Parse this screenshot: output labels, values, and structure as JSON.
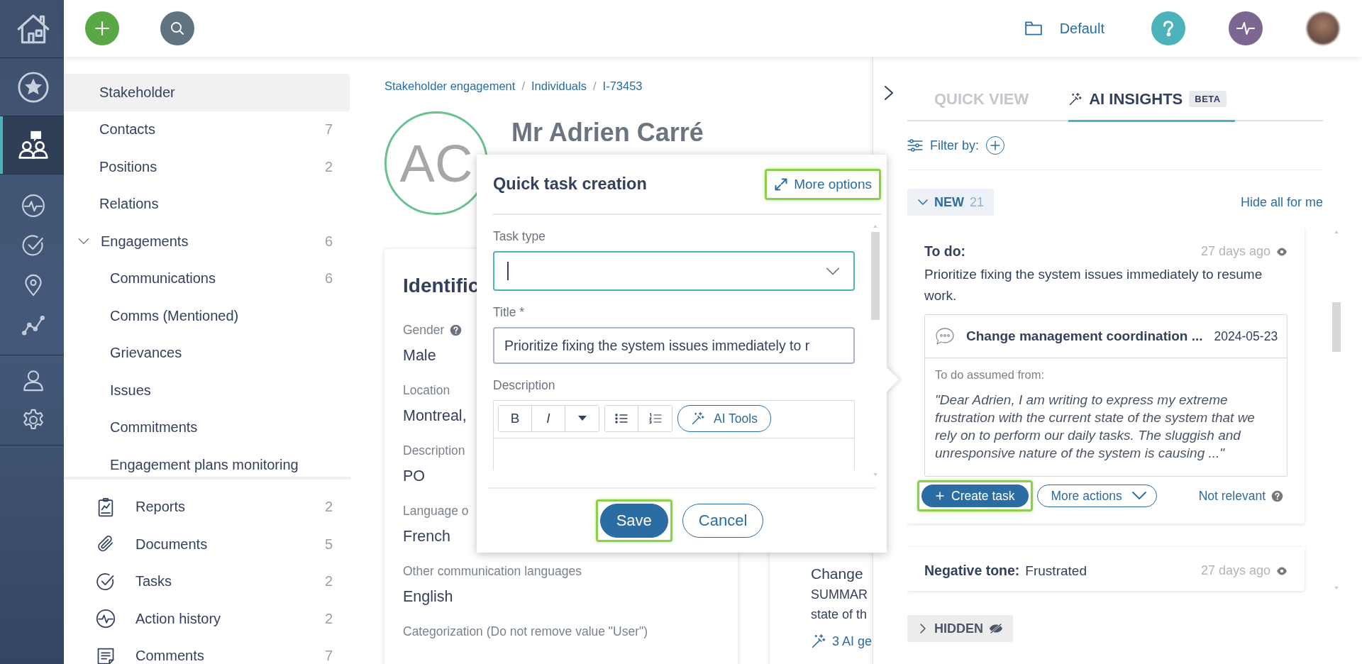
{
  "rail": {
    "groups": [
      {
        "items": [
          {
            "selected": false
          }
        ]
      },
      {
        "items": [
          {
            "selected": false
          }
        ]
      },
      {
        "items": [
          {
            "selected": true
          }
        ]
      },
      {
        "items": [
          {
            "selected": false
          },
          {
            "selected": false
          },
          {
            "selected": false
          },
          {
            "selected": false
          }
        ]
      },
      {
        "items": [
          {
            "selected": false
          },
          {
            "selected": false
          }
        ]
      }
    ]
  },
  "top_bar": {
    "workspace": "Default"
  },
  "sidebar": {
    "sections": [
      {
        "items": [
          {
            "label": "Stakeholder",
            "selected": true
          },
          {
            "label": "Contacts",
            "count": "7",
            "selected": false
          },
          {
            "label": "Positions",
            "count": "2",
            "selected": false
          },
          {
            "label": "Relations",
            "selected": false
          },
          {
            "label": "Engagements",
            "count": "6",
            "selected": false,
            "expanded": true,
            "children": [
              {
                "label": "Communications",
                "count": "6",
                "selected": false
              },
              {
                "label": "Comms (Mentioned)",
                "selected": false
              },
              {
                "label": "Grievances",
                "selected": false
              },
              {
                "label": "Issues",
                "selected": false
              },
              {
                "label": "Commitments",
                "selected": false
              },
              {
                "label": "Engagement plans monitoring",
                "selected": false
              }
            ]
          }
        ]
      },
      {
        "items": [
          {
            "label": "Reports",
            "count": "2",
            "selected": false
          },
          {
            "label": "Documents",
            "count": "5",
            "selected": false
          },
          {
            "label": "Tasks",
            "count": "2",
            "selected": false
          },
          {
            "label": "Action history",
            "count": "2",
            "selected": false
          },
          {
            "label": "Comments",
            "count": "7",
            "selected": false
          }
        ]
      }
    ]
  },
  "breadcrumb": [
    {
      "kind": "link",
      "text": "Stakeholder engagement"
    },
    {
      "kind": "separator",
      "text": "/"
    },
    {
      "kind": "link",
      "text": "Individuals"
    },
    {
      "kind": "separator",
      "text": "/"
    },
    {
      "kind": "link",
      "text": "I-73453"
    }
  ],
  "record": {
    "initials": "AC",
    "name": "Mr Adrien Carré",
    "card_title": "Identific",
    "fields": [
      {
        "label": "Gender",
        "help": true,
        "value": "Male"
      },
      {
        "label": "Location",
        "help": false,
        "value": "Montreal,"
      },
      {
        "label": "Description",
        "help": false,
        "value": "PO"
      },
      {
        "label": "Language o",
        "help": false,
        "value": "French"
      },
      {
        "label": "Other communication languages",
        "help": false,
        "value": "English"
      },
      {
        "label": "Categorization (Do not remove value \"User\")",
        "help": false
      }
    ]
  },
  "side_card": {
    "lines": [
      "Change",
      "SUMMAR",
      "state of th"
    ],
    "link": "3 AI ge"
  },
  "modal": {
    "title": "Quick task creation",
    "more_options": {
      "label": "More options",
      "highlighted": true
    },
    "fields": [
      {
        "label": "Task type",
        "kind": "select"
      },
      {
        "label": "Title *",
        "kind": "text",
        "value": "Prioritize fixing the system issues immediately to r"
      },
      {
        "label": "Description",
        "kind": "editor"
      }
    ],
    "toolbar": [
      {
        "label": "B",
        "kind": "bold"
      },
      {
        "label": "I",
        "kind": "italic"
      }
    ],
    "ai_tools": "AI Tools",
    "buttons": [
      {
        "label": "Save",
        "kind": "primary",
        "highlighted": true
      },
      {
        "label": "Cancel",
        "kind": "secondary",
        "highlighted": false
      }
    ]
  },
  "insights": {
    "tabs": [
      {
        "label": "QUICK VIEW",
        "selected": false
      },
      {
        "label": "AI INSIGHTS",
        "selected": true,
        "badge": "BETA"
      }
    ],
    "filter_label": "Filter by:",
    "new_group": {
      "label": "NEW",
      "count": "21",
      "expanded": true,
      "action": "Hide all for me"
    },
    "cards": [
      {
        "kind": "todo",
        "heading": "To do:",
        "time": "27 days ago",
        "text": "Prioritize fixing the system issues immediately to resume work.",
        "source": {
          "title": "Change management coordination ...",
          "date": "2024-05-23",
          "caption": "To do assumed from:",
          "quote": "\"Dear Adrien, I am writing to express my extreme frustration with the current state of the system that we rely on to perform our daily tasks. The sluggish and unresponsive nature of the system is causing ...\""
        },
        "actions": [
          {
            "label": "Create task",
            "kind": "primary",
            "highlighted": true
          },
          {
            "label": "More actions",
            "kind": "dropdown",
            "highlighted": false
          },
          {
            "label": "Not relevant",
            "kind": "link",
            "highlighted": false
          }
        ]
      },
      {
        "kind": "tone",
        "heading": "Negative tone:",
        "text": "Frustrated",
        "time": "27 days ago"
      }
    ],
    "hidden_group": {
      "label": "HIDDEN",
      "expanded": false
    }
  }
}
